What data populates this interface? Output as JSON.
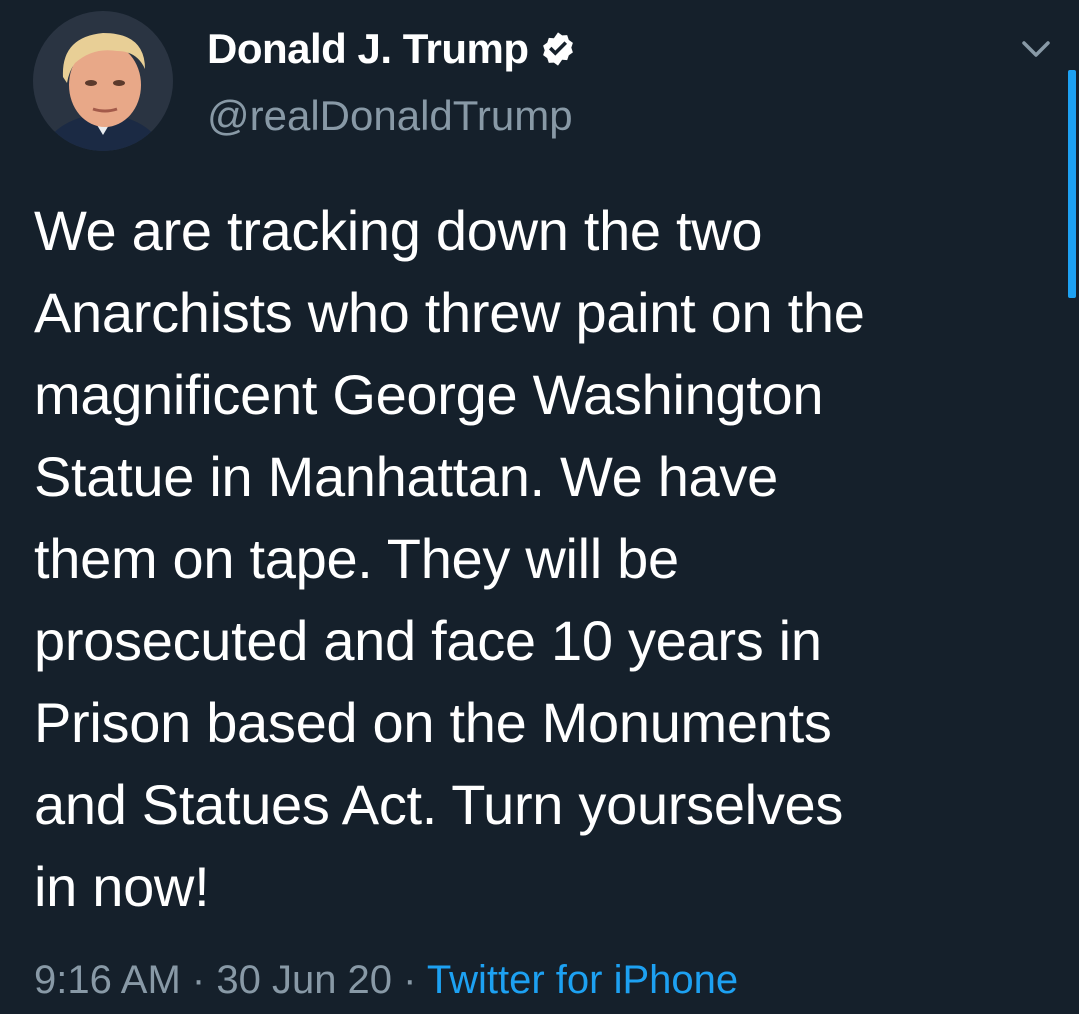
{
  "author": {
    "display_name": "Donald J. Trump",
    "handle": "@realDonaldTrump",
    "verified": true
  },
  "tweet": {
    "text_lines": [
      "We are tracking down the two",
      "Anarchists who threw paint on the",
      "magnificent George Washington",
      "Statue in Manhattan. We have",
      "them on tape. They will be",
      "prosecuted and face 10 years in",
      "Prison based on the Monuments",
      "and Statues Act. Turn yourselves",
      "in now!"
    ],
    "time": "9:16 AM",
    "separator": "·",
    "date": "30 Jun 20",
    "source": "Twitter for iPhone"
  },
  "icons": {
    "verified": "verified-badge-icon",
    "menu": "chevron-down-icon"
  },
  "colors": {
    "background": "#15202b",
    "text_primary": "#ffffff",
    "text_secondary": "#8899a6",
    "accent": "#1da1f2"
  }
}
